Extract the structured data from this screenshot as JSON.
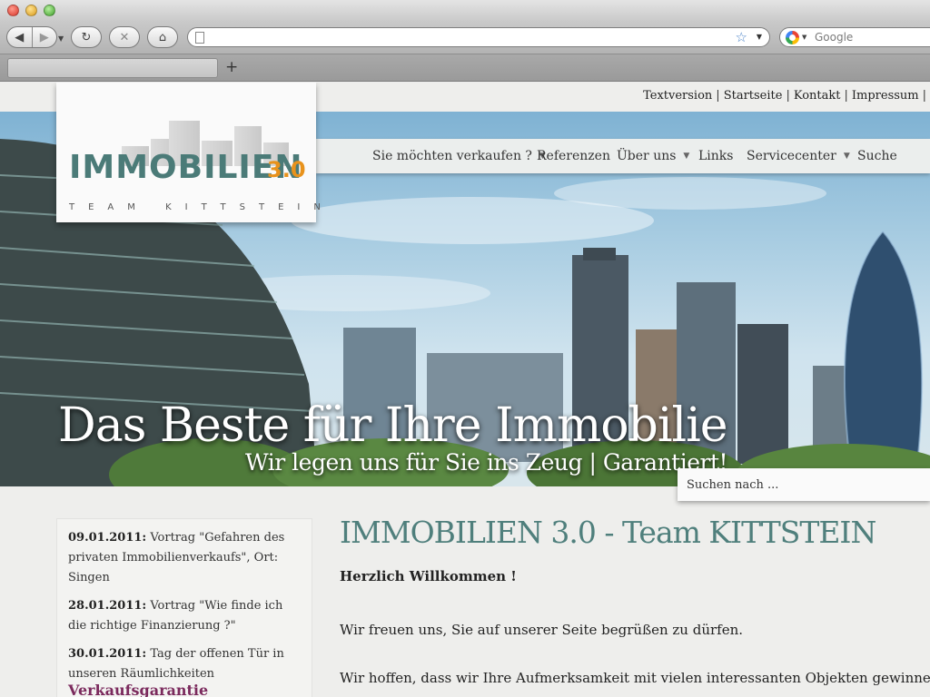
{
  "browser": {
    "search_placeholder": "Google",
    "url_value": "",
    "new_tab_label": "+"
  },
  "site": {
    "top_links": [
      "Textversion",
      "Startseite",
      "Kontakt",
      "Impressum"
    ],
    "logo": {
      "word": "IMMOBILIEN",
      "version": "3.0",
      "tagline": "TEAM KITTSTEIN"
    },
    "nav": [
      {
        "label": "Sie möchten verkaufen ?",
        "dropdown": true
      },
      {
        "label": "Referenzen",
        "dropdown": false
      },
      {
        "label": "Über uns",
        "dropdown": true
      },
      {
        "label": "Links",
        "dropdown": false
      },
      {
        "label": "Servicecenter",
        "dropdown": true
      },
      {
        "label": "Suche",
        "dropdown": false
      }
    ],
    "hero": {
      "title": "Das Beste für Ihre Immobilie",
      "subtitle": "Wir legen uns für Sie ins Zeug | Garantiert!"
    },
    "search_placeholder": "Suchen nach ...",
    "sidebar": {
      "news": [
        {
          "date": "09.01.2011:",
          "text": " Vortrag \"Gefahren des privaten Immobilienverkaufs\", Ort: Singen"
        },
        {
          "date": "28.01.2011:",
          "text": " Vortrag \"Wie finde ich die richtige Finanzierung ?\""
        },
        {
          "date": "30.01.2011:",
          "text": " Tag der offenen Tür in unseren Räumlichkeiten"
        }
      ],
      "heading": "Verkaufsgarantie"
    },
    "content": {
      "title": "IMMOBILIEN 3.0 - Team KITTSTEIN",
      "greeting": "Herzlich Willkommen !",
      "p1": "Wir freuen uns, Sie auf unserer Seite begrüßen zu dürfen.",
      "p2": "Wir hoffen, dass wir Ihre Aufmerksamkeit mit vielen interessanten Objekten gewinnen"
    }
  },
  "colors": {
    "accent_teal": "#4f7f7c",
    "accent_orange": "#e8921c",
    "heading_purple": "#7b2a5d"
  }
}
